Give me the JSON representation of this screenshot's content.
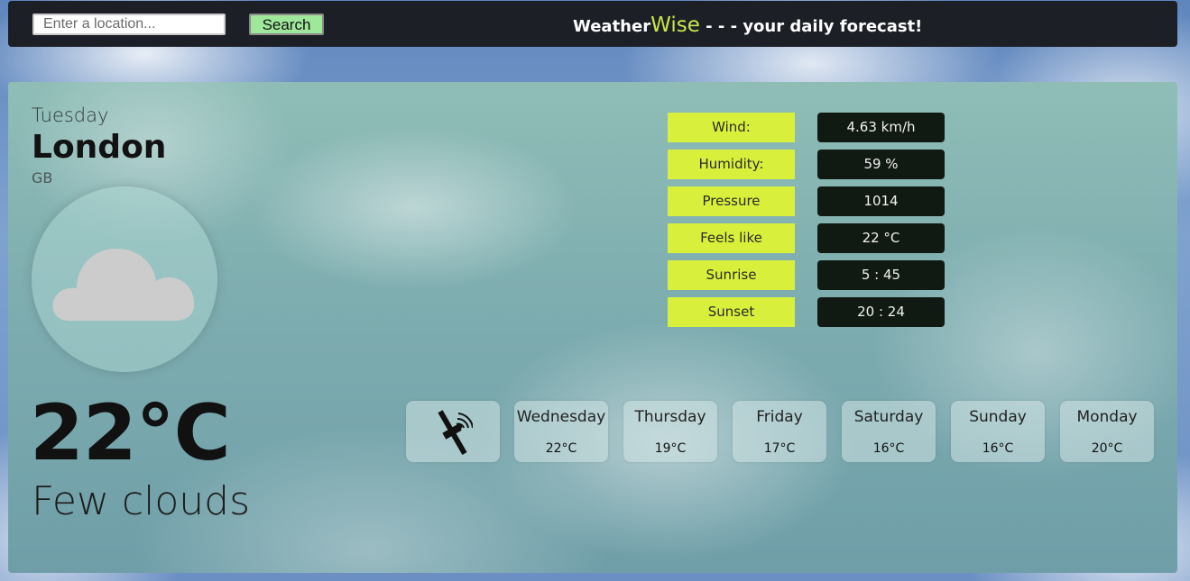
{
  "header": {
    "search_placeholder": "Enter a location...",
    "search_button": "Search",
    "brand_prefix": "Weather",
    "brand_accent": "Wise",
    "brand_suffix": " - - - your daily forecast!"
  },
  "current": {
    "day": "Tuesday",
    "city": "London",
    "country": "GB",
    "icon": "cloud-icon",
    "temperature": "22°C",
    "condition": "Few clouds"
  },
  "details": [
    {
      "label": "Wind:",
      "value": "4.63 km/h"
    },
    {
      "label": "Humidity:",
      "value": "59 %"
    },
    {
      "label": "Pressure",
      "value": "1014"
    },
    {
      "label": "Feels like",
      "value": "22 °C"
    },
    {
      "label": "Sunrise",
      "value": "5 : 45"
    },
    {
      "label": "Sunset",
      "value": "20 : 24"
    }
  ],
  "forecast": {
    "icon": "satellite-icon",
    "days": [
      {
        "day": "Wednesday",
        "temp": "22°C"
      },
      {
        "day": "Thursday",
        "temp": "19°C"
      },
      {
        "day": "Friday",
        "temp": "17°C"
      },
      {
        "day": "Saturday",
        "temp": "16°C"
      },
      {
        "day": "Sunday",
        "temp": "16°C"
      },
      {
        "day": "Monday",
        "temp": "20°C"
      }
    ]
  },
  "colors": {
    "accent": "#c8e64a",
    "label_bg": "#d8f03c",
    "value_bg": "#111a12",
    "button_bg": "#9fe79b"
  }
}
